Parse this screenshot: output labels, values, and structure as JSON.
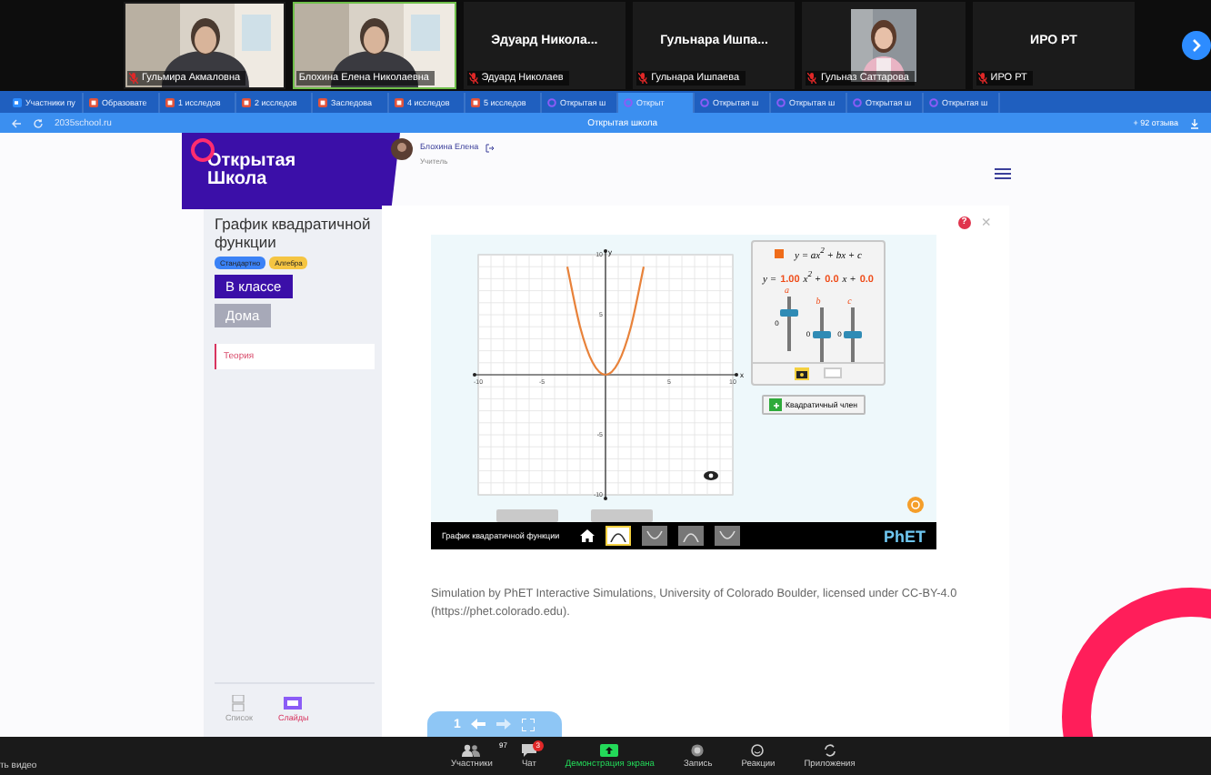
{
  "gallery": {
    "participants": [
      {
        "kind": "video",
        "name": "Гульмира Акмаловна",
        "muted": true
      },
      {
        "kind": "video",
        "name": "Блохина Елена Николаевна",
        "muted": false
      },
      {
        "kind": "name",
        "title": "Эдуард  Никола...",
        "name": "Эдуард Николаев",
        "muted": true
      },
      {
        "kind": "name",
        "title": "Гульнара  Ишпа...",
        "name": "Гульнара Ишпаева",
        "muted": true
      },
      {
        "name": "Гульназ Саттарова",
        "muted": true
      },
      {
        "kind": "name",
        "title": "ИРО РТ",
        "name": "ИРО РТ",
        "muted": true
      }
    ]
  },
  "browser": {
    "tabs": [
      {
        "label": "Участники пу",
        "kind": "zoom",
        "selected": false
      },
      {
        "label": "Образовате",
        "kind": "doc",
        "selected": false
      },
      {
        "label": "1 исследов",
        "kind": "doc",
        "selected": false
      },
      {
        "label": "2 исследов",
        "kind": "doc",
        "selected": false
      },
      {
        "label": "Заследова",
        "kind": "doc",
        "selected": false
      },
      {
        "label": "4 исследов",
        "kind": "doc",
        "selected": false
      },
      {
        "label": "5 исследов",
        "kind": "doc",
        "selected": false
      },
      {
        "label": "Открытая ш",
        "kind": "school",
        "selected": false
      },
      {
        "label": "Открыт",
        "kind": "school",
        "selected": true
      },
      {
        "label": "Открытая ш",
        "kind": "school",
        "selected": false
      },
      {
        "label": "Открытая ш",
        "kind": "school",
        "selected": false
      },
      {
        "label": "Открытая ш",
        "kind": "school",
        "selected": false
      },
      {
        "label": "Открытая ш",
        "kind": "school",
        "selected": false
      }
    ],
    "url": "2035school.ru",
    "title": "Открытая школа",
    "reviews": "+ 92 отзыва"
  },
  "site": {
    "logo": [
      "Открытая",
      "Школа"
    ],
    "user": {
      "name": "Блохина Елена",
      "role": "Учитель"
    },
    "lesson": {
      "title": "График квадратичной функции",
      "tags": [
        {
          "label": "Стандартно",
          "color": "#3b82f6"
        },
        {
          "label": "Алгебра",
          "color": "#f5c542"
        }
      ],
      "modes": [
        {
          "label": "В классе",
          "selected": true
        },
        {
          "label": "Дома",
          "selected": false
        }
      ],
      "menu": [
        {
          "label": "Теория",
          "selected": true
        }
      ],
      "views": [
        {
          "label": "Список",
          "selected": false
        },
        {
          "label": "Слайды",
          "selected": true
        }
      ]
    },
    "help": "?",
    "close": "×",
    "attribution": "Simulation by PhET Interactive Simulations, University of Colorado Boulder, licensed under CC-BY-4.0 (https://phet.colorado.edu).",
    "slide_counter": "1"
  },
  "sim": {
    "equation": "y = ax$^{2}$ + bx + c",
    "prefix": "y =",
    "terms": [
      {
        "value": "1.00",
        "suffix": "x$^{2}$ +"
      },
      {
        "value": "0.0",
        "suffix": "x +"
      },
      {
        "value": "0.0"
      }
    ],
    "sliders": [
      {
        "label": "a",
        "zero": "0",
        "level": 0.7
      },
      {
        "label": "b",
        "zero": "0",
        "level": 0.5
      },
      {
        "label": "c",
        "zero": "0",
        "level": 0.5
      }
    ],
    "quadratic_term": {
      "label": "Квадратичный член",
      "checked": true
    },
    "chart_data": {
      "type": "line",
      "grid": true,
      "xlabel": "x",
      "ylabel": "y",
      "x": [
        -3,
        -2,
        -1,
        0,
        1,
        2,
        3
      ],
      "series": [
        {
          "color": "#e8823a",
          "values": [
            9,
            4,
            1,
            0,
            1,
            4,
            9
          ]
        }
      ],
      "xlim": [
        -10,
        10
      ],
      "ylim": [
        -10,
        10
      ],
      "xticks": [
        -10,
        -5,
        5,
        10
      ],
      "yticks": [
        -10,
        -5,
        5,
        10
      ]
    },
    "title": "График квадратичной функции",
    "screens": [
      {
        "selected": true
      },
      {
        "selected": false
      },
      {
        "selected": false
      },
      {
        "selected": false
      }
    ],
    "logo": "PhET"
  },
  "toolbar": {
    "video": "ть видео",
    "items": [
      {
        "kind": "participants",
        "label": "Участники",
        "count": "97"
      },
      {
        "kind": "chat",
        "label": "Чат",
        "count": "3"
      },
      {
        "kind": "share",
        "label": "Демонстрация экрана"
      },
      {
        "kind": "record",
        "label": "Запись"
      },
      {
        "kind": "reactions",
        "label": "Реакции"
      },
      {
        "kind": "apps",
        "label": "Приложения"
      }
    ]
  }
}
